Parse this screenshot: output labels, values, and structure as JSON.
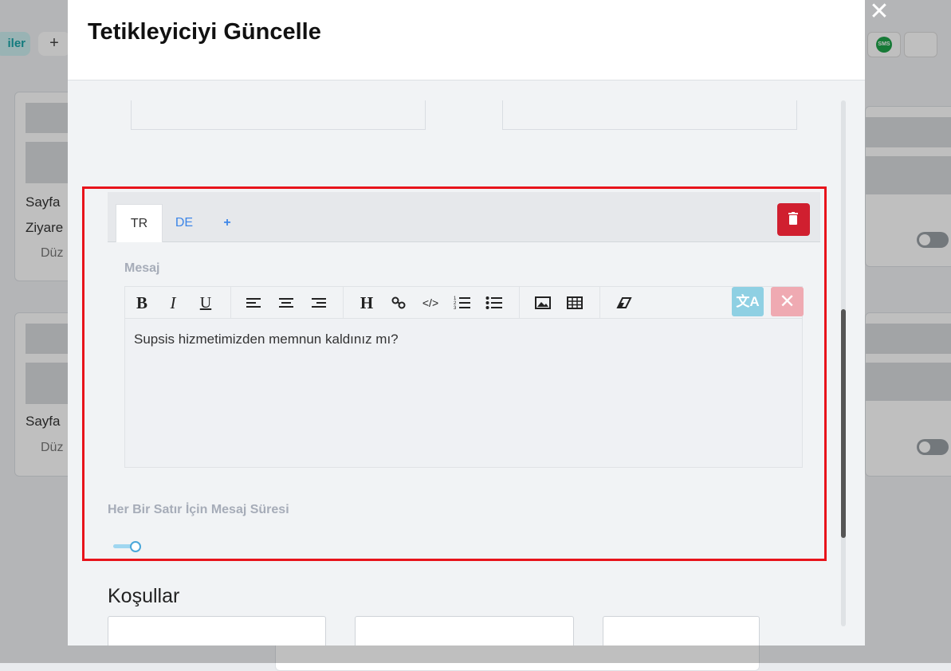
{
  "background": {
    "pill_label": "iler",
    "plus_label": "+",
    "card1": {
      "line1": "Sayfa",
      "line2": "Ziyare",
      "line3": "Düz"
    },
    "card2": {
      "line1": "Sayfa",
      "line2": "Düz"
    },
    "sms_label": "SMS"
  },
  "modal": {
    "title": "Tetikleyiciyi Güncelle",
    "close_label": "✕",
    "tabs": [
      {
        "label": "TR"
      },
      {
        "label": "DE"
      },
      {
        "label": "+"
      }
    ],
    "message_label": "Mesaj",
    "toolbar": {
      "bold": "B",
      "italic": "I",
      "underline": "U",
      "heading": "H",
      "code": "</>",
      "translate": "文A",
      "cancel": "✕"
    },
    "message_text": "Supsis hizmetimizden memnun kaldınız mı?",
    "duration_label": "Her Bir Satır İçin Mesaj Süresi",
    "duration_value": 0.2,
    "conditions_title": "Koşullar"
  },
  "colors": {
    "delete": "#d01f2f",
    "highlight": "#e8131b",
    "link": "#3d86e8"
  }
}
